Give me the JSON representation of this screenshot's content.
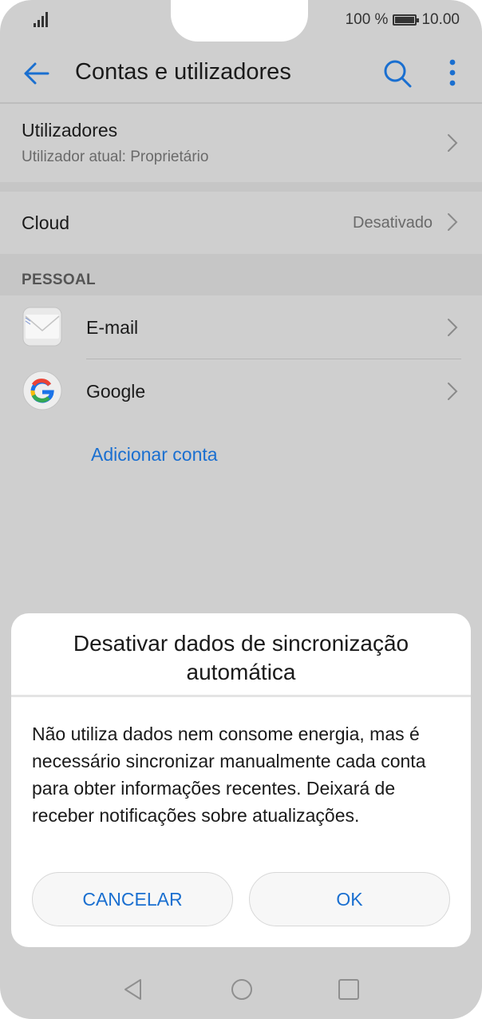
{
  "status_bar": {
    "battery_text": "100 %",
    "time": "10.00"
  },
  "toolbar": {
    "title": "Contas e utilizadores",
    "accent_color": "#1a6fd0"
  },
  "settings": {
    "users_title": "Utilizadores",
    "users_subtitle": "Utilizador atual: Proprietário",
    "cloud_title": "Cloud",
    "cloud_value": "Desativado",
    "section_personal": "PESSOAL",
    "accounts": [
      {
        "label": "E-mail",
        "icon": "email-icon"
      },
      {
        "label": "Google",
        "icon": "google-icon"
      }
    ],
    "add_account": "Adicionar conta"
  },
  "dialog": {
    "title": "Desativar dados de sincronização automática",
    "message": "Não utiliza dados nem consome energia, mas é necessário sincronizar manualmente cada conta para obter informações recentes. Deixará de receber notificações sobre atualizações.",
    "cancel_label": "CANCELAR",
    "ok_label": "OK"
  },
  "nav_bar": {
    "icons": [
      "nav-back-icon",
      "nav-home-icon",
      "nav-recent-icon"
    ]
  }
}
